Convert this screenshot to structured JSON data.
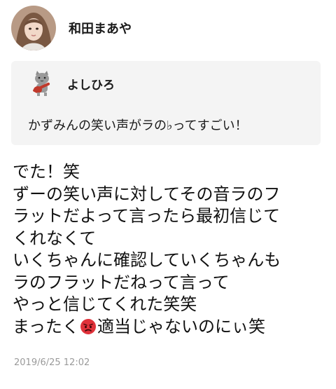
{
  "author": {
    "name": "和田まあや",
    "avatar_icon": "user-photo-avatar"
  },
  "quote": {
    "name": "よしひろ",
    "avatar_icon": "cat-guitar-avatar",
    "text": "かずみんの笑い声がラの♭ってすごい！"
  },
  "post": {
    "lines": [
      "でた！笑",
      "ずーの笑い声に対してその音ラのフ",
      "ラットだよって言ったら最初信じて",
      "くれなくて",
      "いくちゃんに確認していくちゃんも",
      "ラのフラットだねって言って",
      "やっと信じてくれた笑笑"
    ],
    "last_line_before": "まったく",
    "emoji_icon": "angry-face-emoji",
    "last_line_after": "適当じゃないのにぃ笑"
  },
  "timestamp": "2019/6/25 12:02",
  "colors": {
    "card_bg": "#f4f4f4",
    "timestamp": "#9a9a9a",
    "emoji": "#e0323a"
  }
}
